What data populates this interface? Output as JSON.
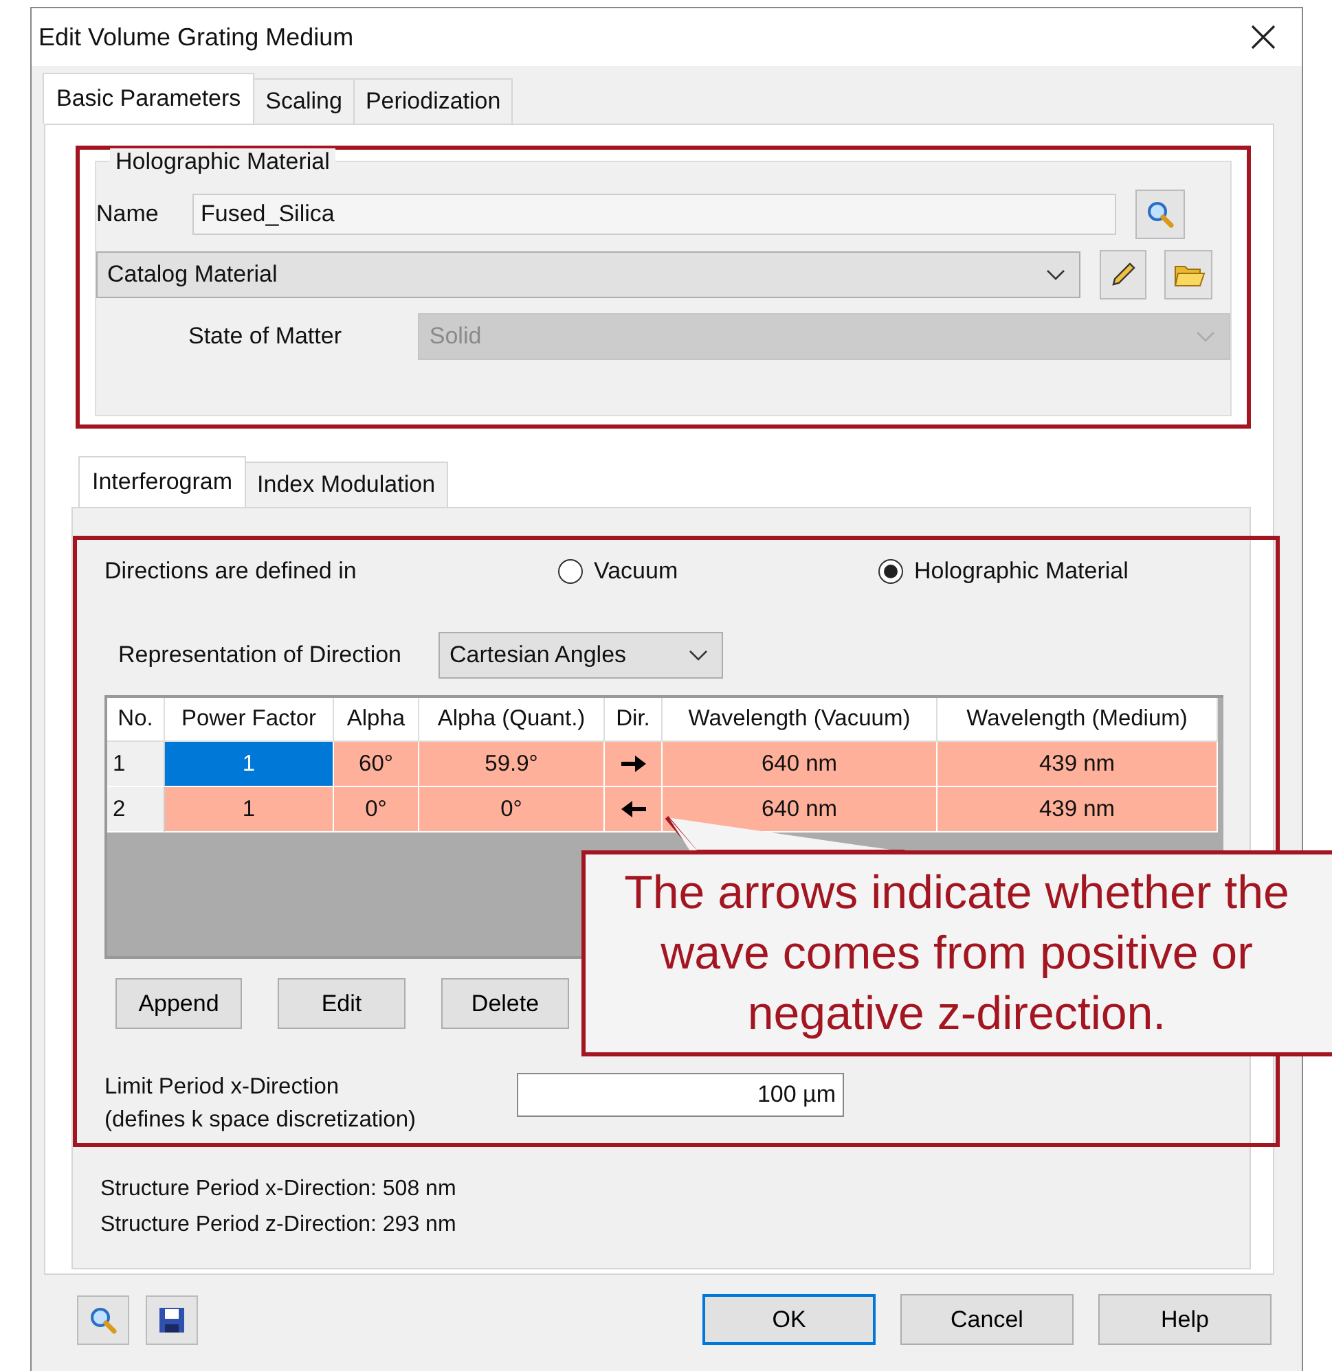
{
  "window": {
    "title": "Edit Volume Grating Medium"
  },
  "tabs": [
    {
      "label": "Basic Parameters",
      "selected": true
    },
    {
      "label": "Scaling",
      "selected": false
    },
    {
      "label": "Periodization",
      "selected": false
    }
  ],
  "material": {
    "title": "Holographic Material",
    "name_label": "Name",
    "name_value": "Fused_Silica",
    "catalog": "Catalog Material",
    "state_label": "State of Matter",
    "state_value": "Solid",
    "state_disabled": true
  },
  "subtabs": [
    {
      "label": "Interferogram",
      "selected": true
    },
    {
      "label": "Index Modulation",
      "selected": false
    }
  ],
  "directions": {
    "label": "Directions are defined in",
    "options": [
      {
        "label": "Vacuum",
        "selected": false
      },
      {
        "label": "Holographic Material",
        "selected": true
      }
    ]
  },
  "representation": {
    "label": "Representation of Direction",
    "value": "Cartesian Angles"
  },
  "table": {
    "columns": [
      "No.",
      "Power Factor",
      "Alpha",
      "Alpha (Quant.)",
      "Dir.",
      "Wavelength (Vacuum)",
      "Wavelength (Medium)"
    ],
    "rows": [
      {
        "no": "1",
        "power": "1",
        "power_selected": true,
        "alpha": "60°",
        "alpha_q": "59.9°",
        "kind": "right",
        "wl_vac": "640 nm",
        "wl_med": "439 nm"
      },
      {
        "no": "2",
        "power": "1",
        "power_selected": false,
        "alpha": "0°",
        "alpha_q": "0°",
        "kind": "left",
        "wl_vac": "640 nm",
        "wl_med": "439 nm"
      }
    ]
  },
  "table_buttons": [
    "Append",
    "Edit",
    "Delete"
  ],
  "limit": {
    "label_lines": [
      "Limit Period x-Direction",
      "(defines k space discretization)"
    ],
    "value": "100 µm"
  },
  "structure_lines": [
    "Structure Period x-Direction: 508 nm",
    "Structure Period z-Direction: 293 nm"
  ],
  "footer_buttons": [
    {
      "label": "OK",
      "default": true
    },
    {
      "label": "Cancel",
      "default": false
    },
    {
      "label": "Help",
      "default": false
    }
  ],
  "callout": {
    "text": "The arrows indicate whether the wave comes from positive or negative z-direction."
  }
}
